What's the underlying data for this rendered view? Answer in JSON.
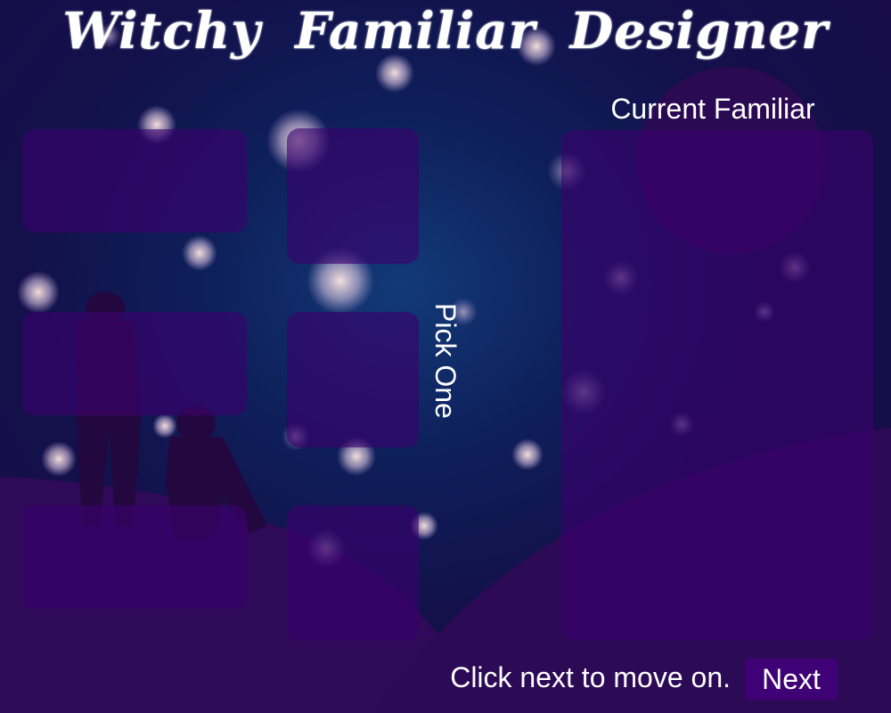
{
  "title": "Witchy Familiar Designer",
  "preview": {
    "label": "Current Familiar"
  },
  "picker": {
    "prompt": "Pick One",
    "option_slots": 6
  },
  "footer": {
    "instruction": "Click next to move on.",
    "next_label": "Next"
  },
  "colors": {
    "night_sky": "#0e1f5a",
    "panel": "#3a006e",
    "text": "#ffffff"
  }
}
